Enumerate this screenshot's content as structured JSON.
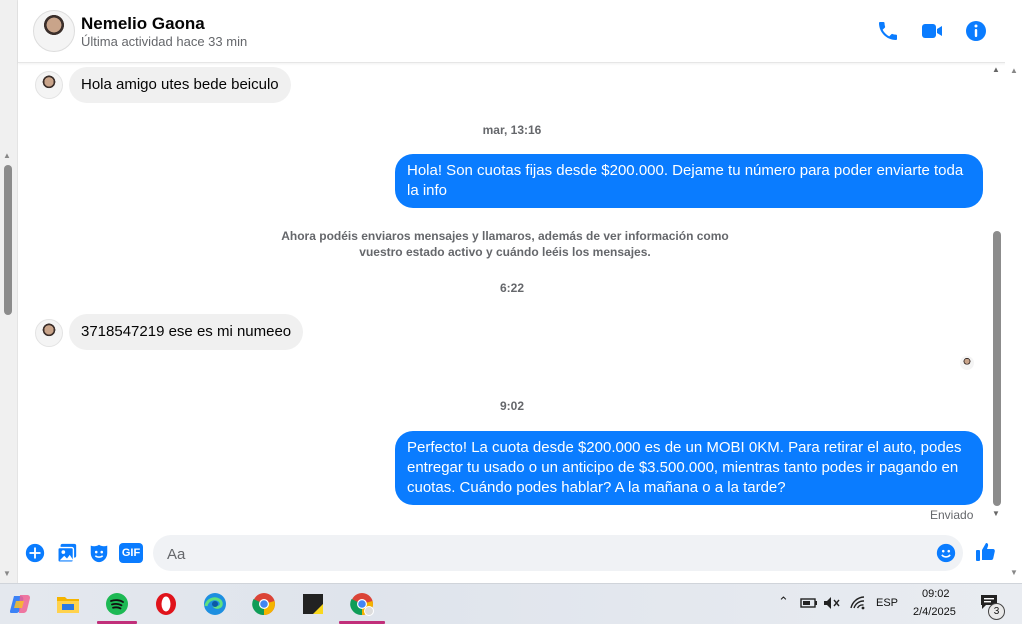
{
  "contact": {
    "name": "Nemelio Gaona",
    "status": "Última actividad hace 33 min"
  },
  "messages": {
    "in1": "Hola amigo utes bede beiculo",
    "ts1": "mar, 13:16",
    "out1": "Hola! Son cuotas fijas desde $200.000. Dejame tu número para poder enviarte toda la info",
    "notice": "Ahora podéis enviaros mensajes y llamaros, además de ver información como vuestro estado activo y cuándo leéis los mensajes.",
    "ts2": "6:22",
    "in2": "3718547219 ese es mi numeeo",
    "ts3": "9:02",
    "out2": "Perfecto! La cuota desde $200.000 es de un MOBI 0KM. Para retirar el auto, podes entregar tu usado o un anticipo de $3.500.000, mientras tanto podes ir pagando en cuotas. Cuándo podes hablar? A la mañana o a la tarde?",
    "sent_status": "Enviado"
  },
  "composer": {
    "placeholder": "Aa",
    "gif_label": "GIF"
  },
  "taskbar": {
    "language": "ESP",
    "time": "09:02",
    "date": "2/4/2025",
    "notification_count": "3"
  },
  "colors": {
    "accent": "#0a7cff",
    "incoming_bubble": "#f0f0f0"
  }
}
